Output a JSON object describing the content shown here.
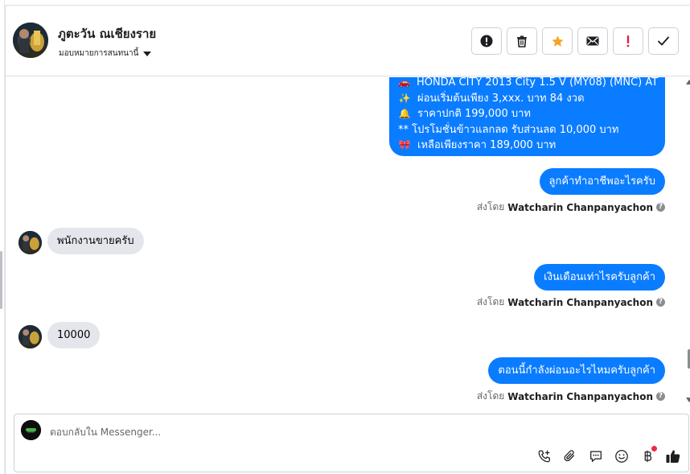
{
  "header": {
    "contact_name": "ภูตะวัน ณเชียงราย",
    "assign_label": "มอบหมายการสนทนานี้",
    "actions": [
      {
        "icon": "alert-circle-icon",
        "color": "#1c1e21"
      },
      {
        "icon": "trash-icon",
        "color": "#1c1e21"
      },
      {
        "icon": "star-icon",
        "color": "#f5a623"
      },
      {
        "icon": "mail-icon",
        "color": "#1c1e21"
      },
      {
        "icon": "exclamation-icon",
        "color": "#e41e3f"
      },
      {
        "icon": "check-icon",
        "color": "#1c1e21"
      }
    ]
  },
  "promo": {
    "lines": [
      {
        "icon": "🚗",
        "text": "HONDA CITY 2013 City 1.5 V (MY08) (MNC) AT"
      },
      {
        "icon": "✨",
        "text": "ผ่อนเริ่มต้นเพียง 3,xxx. บาท 84 งวด"
      },
      {
        "icon": "🔔",
        "text": "ราคาปกติ 199,000 บาท"
      },
      {
        "icon": "",
        "text": "** โปรโมชั่นข้าวแลกลด รับส่วนลด 10,000 บาท"
      },
      {
        "icon": "🎀",
        "text": "เหลือเพียงราคา 189,000 บาท"
      }
    ]
  },
  "messages": [
    {
      "dir": "out",
      "text": "ลูกค้าทำอาชีพอะไรครับ",
      "sent_prefix": "ส่งโดย",
      "sender": "Watcharin Chanpanyachon"
    },
    {
      "dir": "in",
      "text": "พนักงานขายครับ"
    },
    {
      "dir": "out",
      "text": "เงินเดือนเท่าไรครับลูกค้า",
      "sent_prefix": "ส่งโดย",
      "sender": "Watcharin Chanpanyachon"
    },
    {
      "dir": "in",
      "text": "10000"
    },
    {
      "dir": "out",
      "text": "ตอนนี้กำลังผ่อนอะไรไหมครับลูกค้า",
      "sent_prefix": "ส่งโดย",
      "sender": "Watcharin Chanpanyachon"
    }
  ],
  "composer": {
    "placeholder": "ตอบกลับใน Messenger...",
    "tools": [
      "phone-plus-icon",
      "paperclip-icon",
      "chat-bubble-icon",
      "smiley-icon",
      "baht-icon",
      "thumbs-up-icon"
    ]
  },
  "colors": {
    "outgoing_bubble": "#0a7cff",
    "incoming_bubble": "#e4e6eb",
    "star": "#f5a623",
    "alert": "#e41e3f"
  }
}
